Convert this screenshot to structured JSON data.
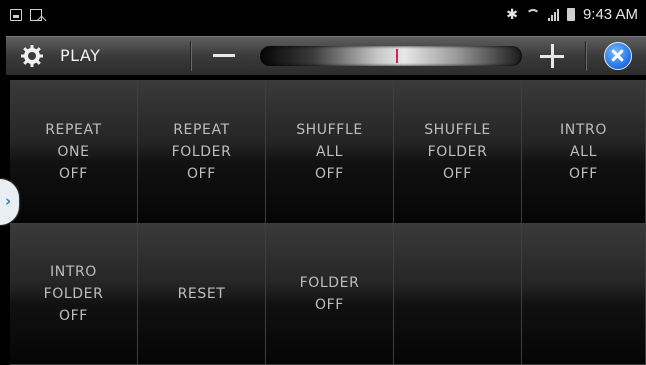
{
  "status_bar": {
    "left_icons": [
      "picture-icon",
      "document-icon"
    ],
    "right_icons": [
      "bluetooth-icon",
      "wifi-icon",
      "signal-icon",
      "battery-icon"
    ],
    "time": "9:43 AM"
  },
  "header": {
    "title": "PLAY",
    "icons": {
      "settings": "gear-icon",
      "volume_down": "minus-icon",
      "volume_up": "plus-icon",
      "close": "close-icon"
    },
    "level_marker": 0.52
  },
  "side_tab": {
    "glyph": "›"
  },
  "grid": {
    "cells": [
      {
        "label": "REPEAT\nONE\nOFF"
      },
      {
        "label": "REPEAT\nFOLDER\nOFF"
      },
      {
        "label": "SHUFFLE\nALL\nOFF"
      },
      {
        "label": "SHUFFLE\nFOLDER\nOFF"
      },
      {
        "label": "INTRO\nALL\nOFF"
      },
      {
        "label": "INTRO\nFOLDER\nOFF"
      },
      {
        "label": "RESET"
      },
      {
        "label": "FOLDER\nOFF"
      },
      {
        "label": ""
      },
      {
        "label": ""
      }
    ]
  },
  "colors": {
    "accent_blue": "#1d6fe0",
    "marker": "#d0205a",
    "text": "#bdbdbd"
  }
}
